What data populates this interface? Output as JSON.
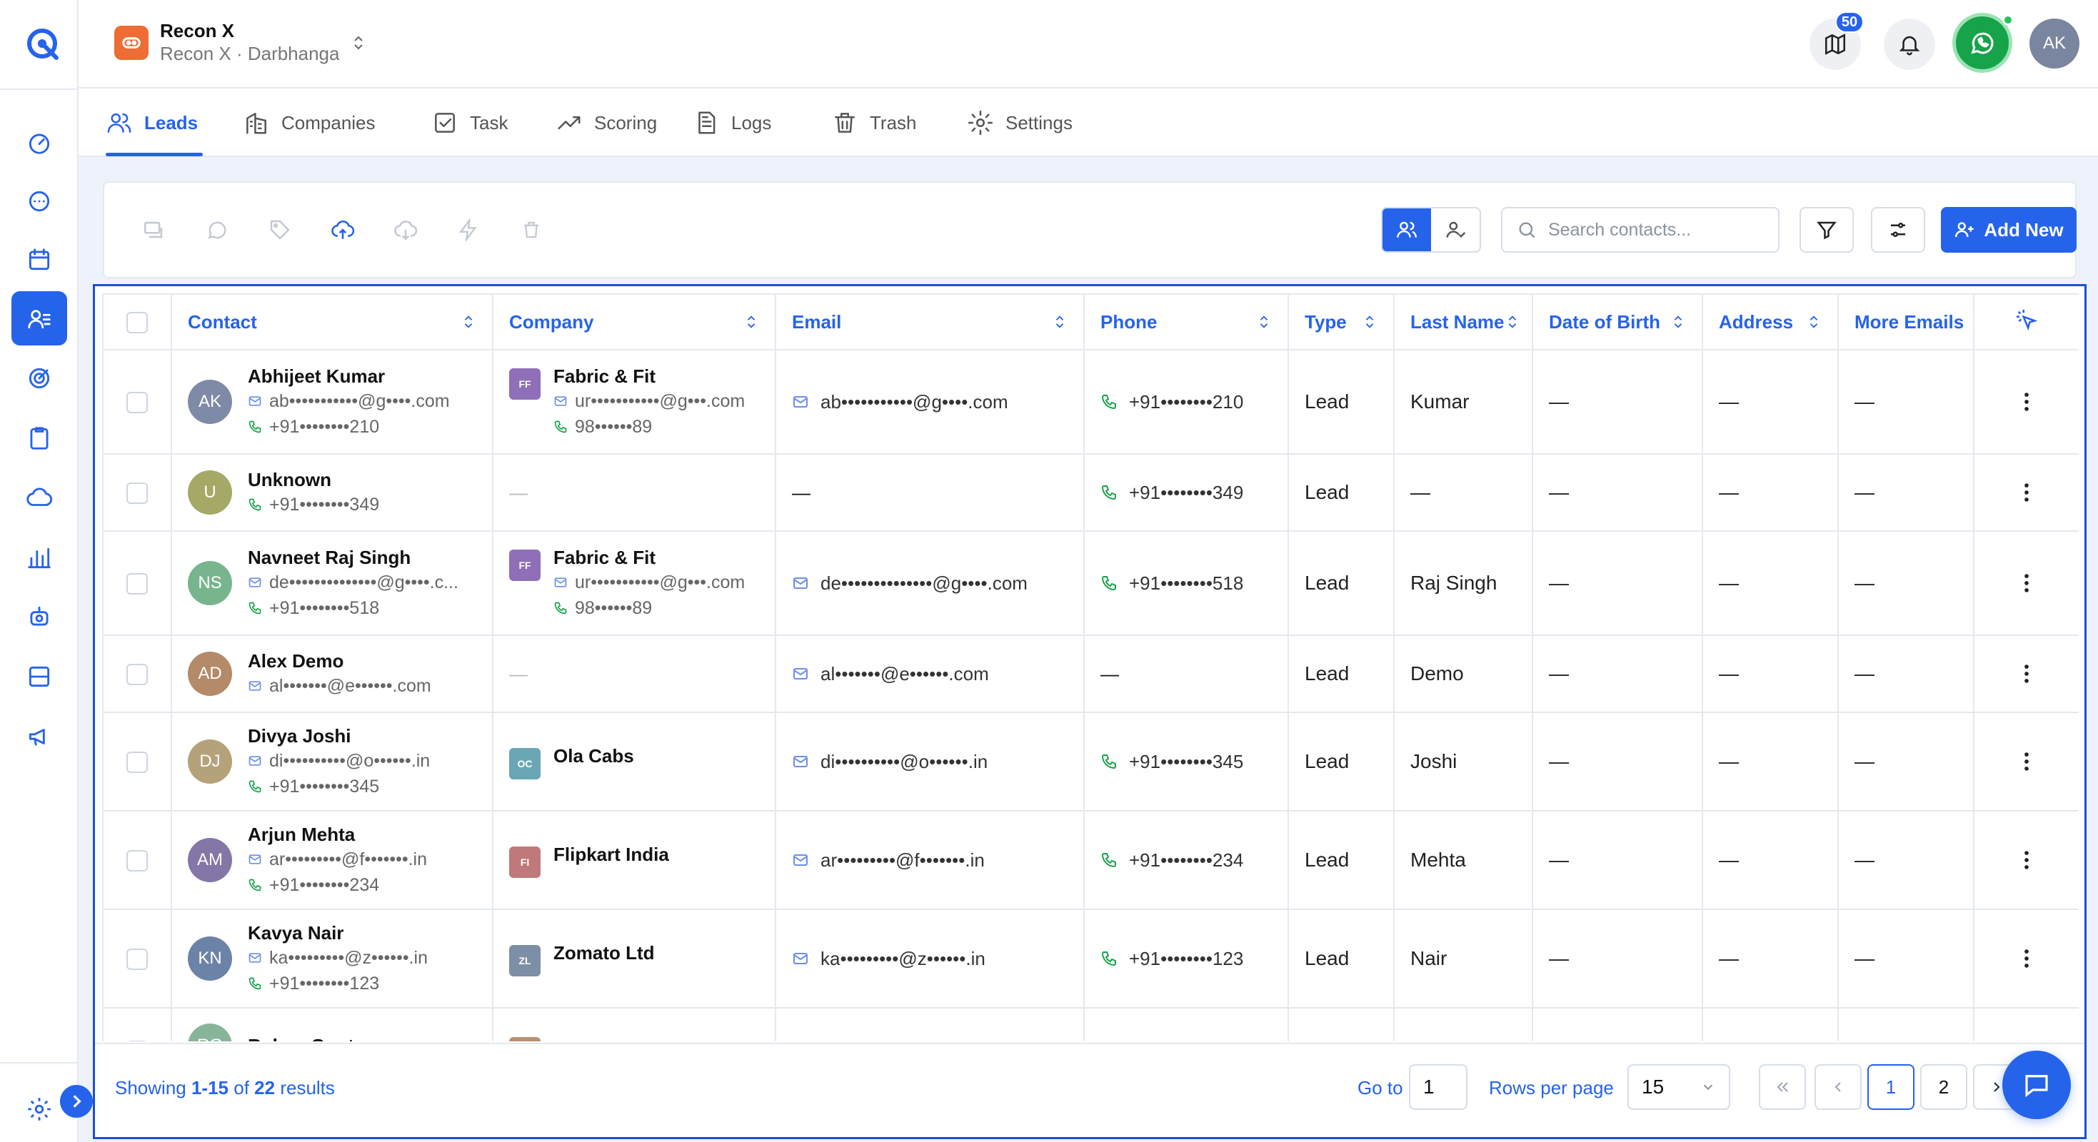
{
  "org": {
    "name": "Recon X",
    "subtitle": "Recon X · Darbhanga"
  },
  "header": {
    "notification_count": "50",
    "user_initials": "AK"
  },
  "sidebar": {
    "items": [
      {
        "icon": "dashboard-icon"
      },
      {
        "icon": "chat-icon"
      },
      {
        "icon": "calendar-icon"
      },
      {
        "icon": "contacts-icon",
        "active": true
      },
      {
        "icon": "target-icon"
      },
      {
        "icon": "clipboard-icon"
      },
      {
        "icon": "cloud-icon"
      },
      {
        "icon": "bar-chart-icon"
      },
      {
        "icon": "robot-icon"
      },
      {
        "icon": "inbox-icon"
      },
      {
        "icon": "megaphone-icon"
      }
    ],
    "bottom_icon": "settings-icon"
  },
  "tabs": [
    {
      "label": "Leads",
      "icon": "users-icon",
      "active": true
    },
    {
      "label": "Companies",
      "icon": "building-icon"
    },
    {
      "label": "Task",
      "icon": "checkbox-icon"
    },
    {
      "label": "Scoring",
      "icon": "trend-icon"
    },
    {
      "label": "Logs",
      "icon": "document-icon"
    },
    {
      "label": "Trash",
      "icon": "trash-icon"
    },
    {
      "label": "Settings",
      "icon": "gear-icon"
    }
  ],
  "toolbar": {
    "search_placeholder": "Search contacts...",
    "add_new_label": "Add New"
  },
  "table": {
    "columns": [
      "Contact",
      "Company",
      "Email",
      "Phone",
      "Type",
      "Last Name",
      "Date of Birth",
      "Address",
      "More Emails"
    ],
    "rows": [
      {
        "initials": "AK",
        "avatar_color": "#7f8aa6",
        "name": "Abhijeet Kumar",
        "c_email": "ab•••••••••••@g••••.com",
        "c_phone": "+91••••••••210",
        "company": "Fabric & Fit",
        "company_badge": "FF",
        "badge_color": "#8e6fb8",
        "co_email": "ur•••••••••••@g•••.com",
        "co_phone": "98••••••89",
        "email": "ab•••••••••••@g••••.com",
        "phone": "+91••••••••210",
        "type": "Lead",
        "last_name": "Kumar",
        "dob": "—",
        "address": "—",
        "more_emails": "—"
      },
      {
        "initials": "U",
        "avatar_color": "#a6a866",
        "name": "Unknown",
        "c_email": "",
        "c_phone": "+91••••••••349",
        "company": "",
        "company_badge": "",
        "badge_color": "",
        "co_email": "",
        "co_phone": "",
        "email": "—",
        "phone": "+91••••••••349",
        "type": "Lead",
        "last_name": "—",
        "dob": "—",
        "address": "—",
        "more_emails": "—"
      },
      {
        "initials": "NS",
        "avatar_color": "#78b58e",
        "name": "Navneet Raj Singh",
        "c_email": "de••••••••••••••@g••••.c...",
        "c_phone": "+91••••••••518",
        "company": "Fabric & Fit",
        "company_badge": "FF",
        "badge_color": "#8e6fb8",
        "co_email": "ur•••••••••••@g•••.com",
        "co_phone": "98••••••89",
        "email": "de••••••••••••••@g••••.com",
        "phone": "+91••••••••518",
        "type": "Lead",
        "last_name": "Raj Singh",
        "dob": "—",
        "address": "—",
        "more_emails": "—"
      },
      {
        "initials": "AD",
        "avatar_color": "#b48a68",
        "name": "Alex Demo",
        "c_email": "al•••••••@e••••••.com",
        "c_phone": "",
        "company": "",
        "company_badge": "",
        "badge_color": "",
        "co_email": "",
        "co_phone": "",
        "email": "al•••••••@e••••••.com",
        "phone": "—",
        "type": "Lead",
        "last_name": "Demo",
        "dob": "—",
        "address": "—",
        "more_emails": "—"
      },
      {
        "initials": "DJ",
        "avatar_color": "#b6a27a",
        "name": "Divya Joshi",
        "c_email": "di••••••••••@o••••••.in",
        "c_phone": "+91••••••••345",
        "company": "Ola Cabs",
        "company_badge": "OC",
        "badge_color": "#6aa6b4",
        "co_email": "",
        "co_phone": "",
        "email": "di••••••••••@o••••••.in",
        "phone": "+91••••••••345",
        "type": "Lead",
        "last_name": "Joshi",
        "dob": "—",
        "address": "—",
        "more_emails": "—"
      },
      {
        "initials": "AM",
        "avatar_color": "#8576a8",
        "name": "Arjun Mehta",
        "c_email": "ar•••••••••@f•••••••.in",
        "c_phone": "+91••••••••234",
        "company": "Flipkart India",
        "company_badge": "FI",
        "badge_color": "#c0797a",
        "co_email": "",
        "co_phone": "",
        "email": "ar•••••••••@f•••••••.in",
        "phone": "+91••••••••234",
        "type": "Lead",
        "last_name": "Mehta",
        "dob": "—",
        "address": "—",
        "more_emails": "—"
      },
      {
        "initials": "KN",
        "avatar_color": "#6c83a8",
        "name": "Kavya Nair",
        "c_email": "ka•••••••••@z••••••.in",
        "c_phone": "+91••••••••123",
        "company": "Zomato Ltd",
        "company_badge": "ZL",
        "badge_color": "#7d8fa6",
        "co_email": "",
        "co_phone": "",
        "email": "ka•••••••••@z••••••.in",
        "phone": "+91••••••••123",
        "type": "Lead",
        "last_name": "Nair",
        "dob": "—",
        "address": "—",
        "more_emails": "—"
      },
      {
        "initials": "RG",
        "avatar_color": "#88b59a",
        "name": "Rohan Gupta",
        "c_email": "",
        "c_phone": "",
        "company": "",
        "company_badge": "",
        "badge_color": "#b89072",
        "co_email": "",
        "co_phone": "",
        "email": "",
        "phone": "",
        "type": "",
        "last_name": "",
        "dob": "",
        "address": "",
        "more_emails": ""
      }
    ]
  },
  "footer": {
    "showing_prefix": "Showing",
    "showing_range": "1-15",
    "showing_of": "of",
    "showing_total": "22",
    "showing_suffix": "results",
    "goto_label": "Go to",
    "goto_value": "1",
    "rows_label": "Rows per page",
    "rows_value": "15",
    "pages": [
      "1",
      "2"
    ],
    "current_page": "1"
  },
  "colors": {
    "accent": "#2563eb",
    "whatsapp": "#16a34a",
    "org_logo": "#ef6c35",
    "phone_icon": "#16a34a"
  }
}
